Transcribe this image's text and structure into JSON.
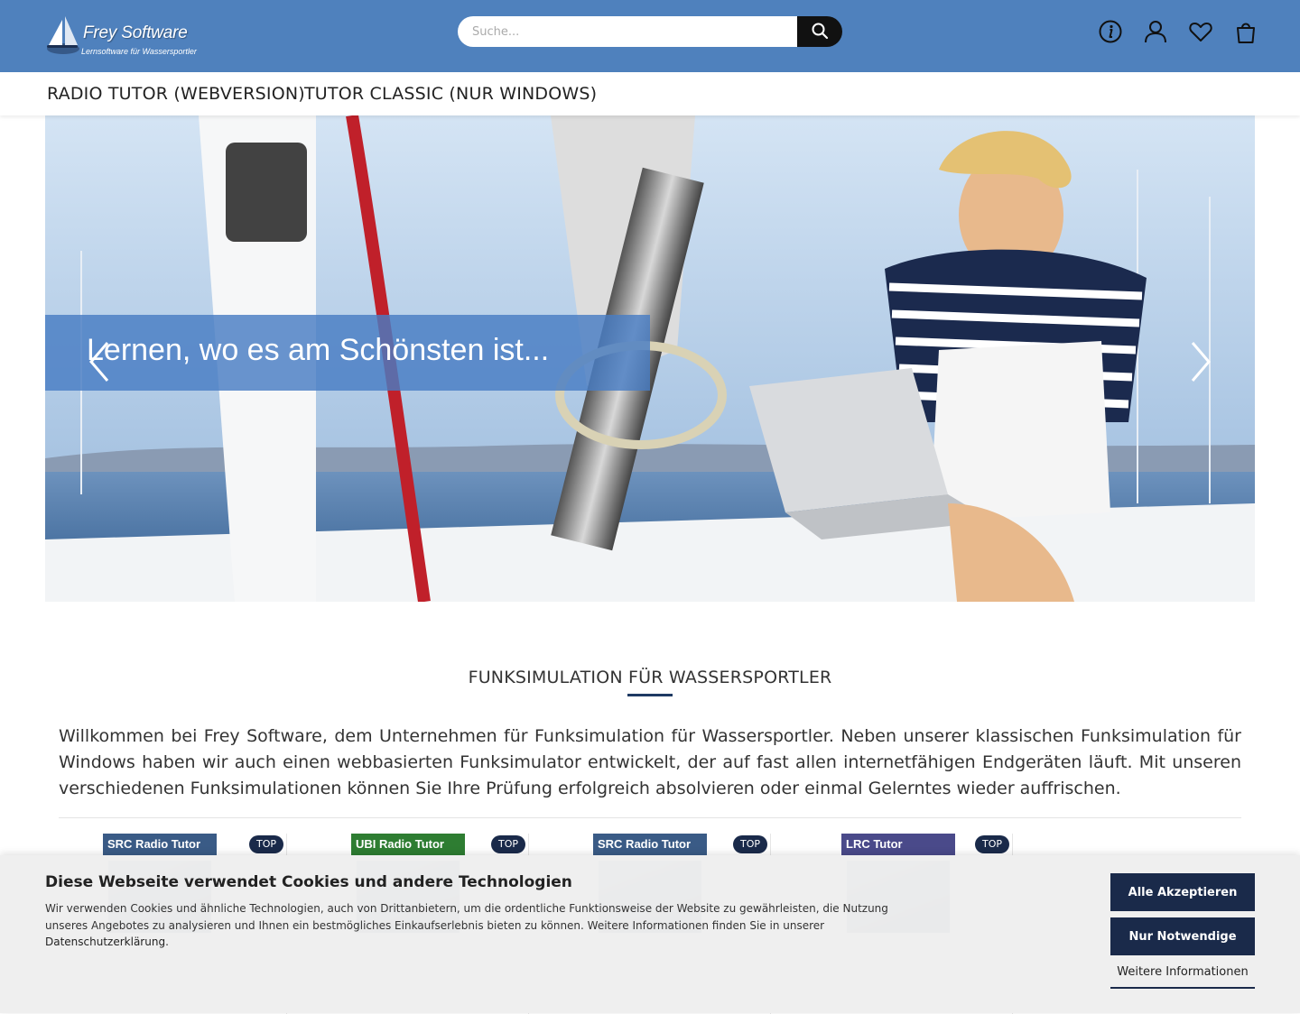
{
  "header": {
    "logo": {
      "brand": "Frey Software",
      "tagline": "Lernsoftware für Wassersportler"
    },
    "search": {
      "placeholder": "Suche..."
    },
    "icons": [
      "info-icon",
      "account-icon",
      "heart-icon",
      "bag-icon"
    ],
    "colors": {
      "bar": "#4f81bd",
      "search_button": "#111111"
    }
  },
  "nav": {
    "items": [
      {
        "label": "Radio Tutor (Webversion)"
      },
      {
        "label": "Tutor Classic (nur Windows)"
      }
    ]
  },
  "hero": {
    "banner_text": "Lernen, wo es am Schönsten ist...",
    "prev_icon": "chevron-left-icon",
    "next_icon": "chevron-right-icon"
  },
  "section": {
    "title": "Funksimulation für Wassersportler",
    "intro": "Willkommen bei Frey Software, dem Unternehmen für Funksimulation für Wassersportler. Neben unserer klassischen Funksimulation für Windows haben wir auch einen webbasierten Funksimulator entwickelt, der auf fast allen internetfähigen Endgeräten läuft. Mit unseren verschiedenen Funksimulationen können Sie Ihre Prüfung erfolgreich absolvieren oder einmal Gelerntes wieder auffrischen."
  },
  "products": [
    {
      "badge": "TOP",
      "box_title": "SRC Radio Tutor",
      "accent": "#3a5b86"
    },
    {
      "badge": "TOP",
      "box_title": "UBI Radio Tutor",
      "accent": "#2e7d32"
    },
    {
      "badge": "TOP",
      "box_title": "SRC Radio Tutor",
      "accent": "#3a5b86"
    },
    {
      "badge": "TOP",
      "box_title": "LRC Tutor",
      "accent": "#4a4a8a"
    }
  ],
  "cookie": {
    "title": "Diese Webseite verwendet Cookies und andere Technologien",
    "text": "Wir verwenden Cookies und ähnliche Technologien, auch von Drittanbietern, um die ordentliche Funktionsweise der Website zu gewährleisten, die Nutzung unseres Angebotes zu analysieren und Ihnen ein bestmögliches Einkaufserlebnis bieten zu können. Weitere Informationen finden Sie in unserer",
    "privacy_link": "Datenschutzerklärung",
    "accept_all": "Alle Akzeptieren",
    "only_necessary": "Nur Notwendige",
    "more_info": "Weitere Informationen"
  }
}
